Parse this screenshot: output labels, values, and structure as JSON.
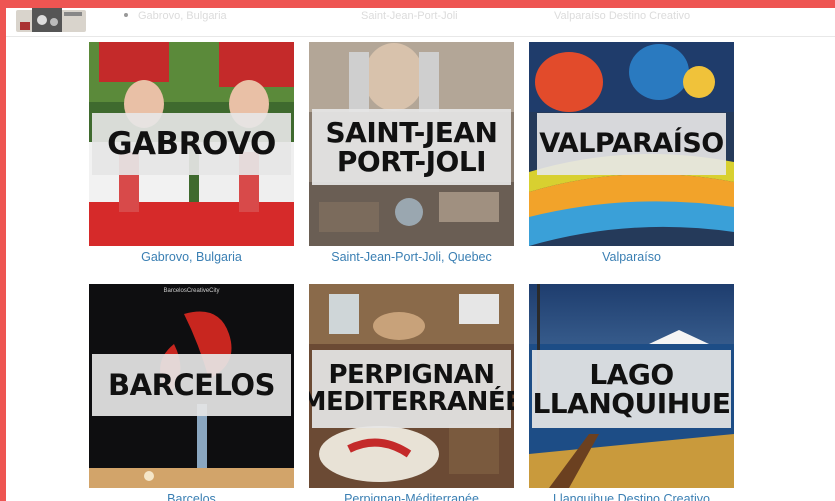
{
  "header": {
    "nav": [
      "Gabrovo, Bulgaria",
      "Saint-Jean-Port-Joli",
      "Valparaíso Destino Creativo"
    ]
  },
  "cities": [
    {
      "title": "GABROVO",
      "caption": "Gabrovo, Bulgaria"
    },
    {
      "title": "SAINT-JEAN\nPORT-JOLI",
      "caption": "Saint-Jean-Port-Joli, Quebec"
    },
    {
      "title": "VALPARAÍSO",
      "caption": "Valparaíso"
    },
    {
      "title": "BARCELOS",
      "caption": "Barcelos",
      "tag": "BarcelosCreativeCity"
    },
    {
      "title": "PERPIGNAN\nMEDITERRANÉE",
      "caption": "Perpignan-Méditerranée"
    },
    {
      "title": "LAGO\nLLANQUIHUE",
      "caption": "Llanquihue Destino Creativo"
    }
  ]
}
